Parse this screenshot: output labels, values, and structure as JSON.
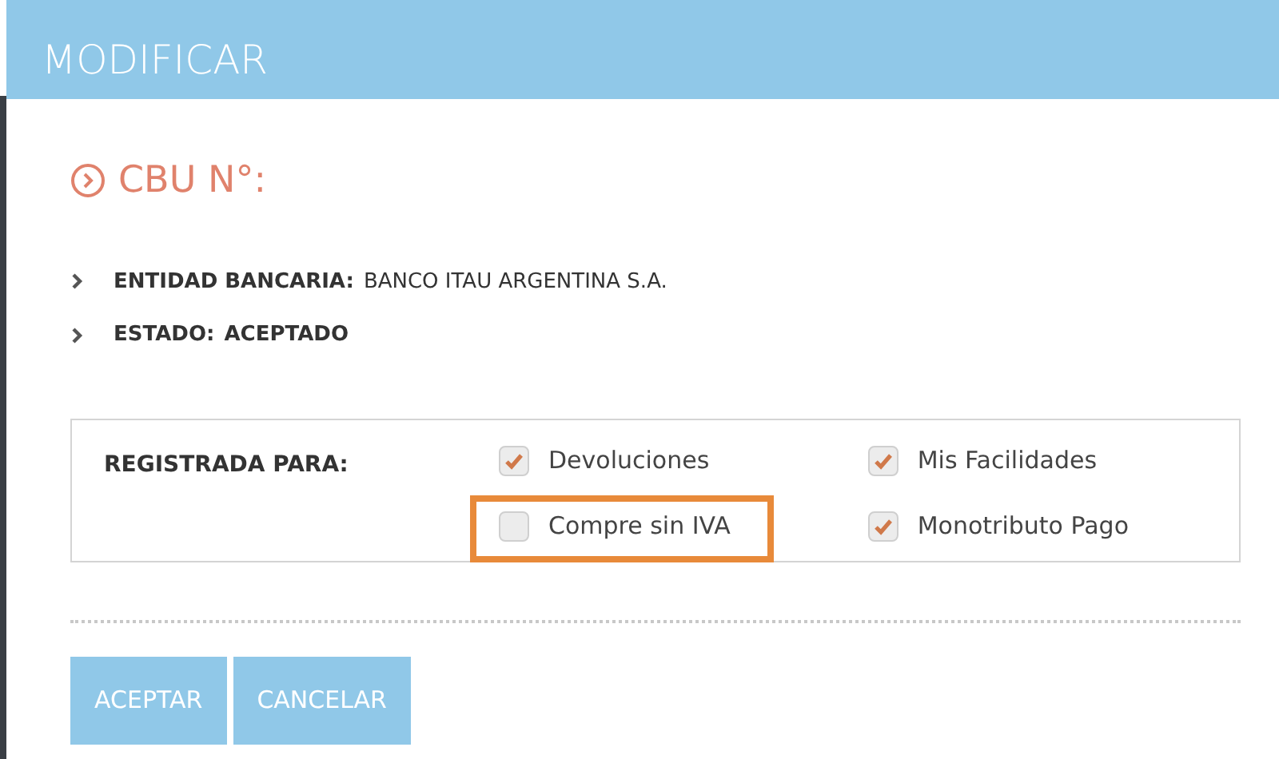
{
  "window": {
    "title": "MODIFICAR"
  },
  "heading": "CBU N°:",
  "details": [
    {
      "label": "ENTIDAD BANCARIA:",
      "value": "BANCO ITAU ARGENTINA S.A.",
      "value_bold": false
    },
    {
      "label": "ESTADO:",
      "value": "ACEPTADO",
      "value_bold": true
    }
  ],
  "registration": {
    "label": "REGISTRADA PARA:",
    "options": [
      {
        "label": "Devoluciones",
        "checked": true,
        "highlighted": false
      },
      {
        "label": "Compre sin IVA",
        "checked": false,
        "highlighted": true
      },
      {
        "label": "Mis Facilidades",
        "checked": true,
        "highlighted": false
      },
      {
        "label": "Monotributo Pago",
        "checked": true,
        "highlighted": false
      }
    ]
  },
  "buttons": [
    "ACEPTAR",
    "CANCELAR"
  ]
}
